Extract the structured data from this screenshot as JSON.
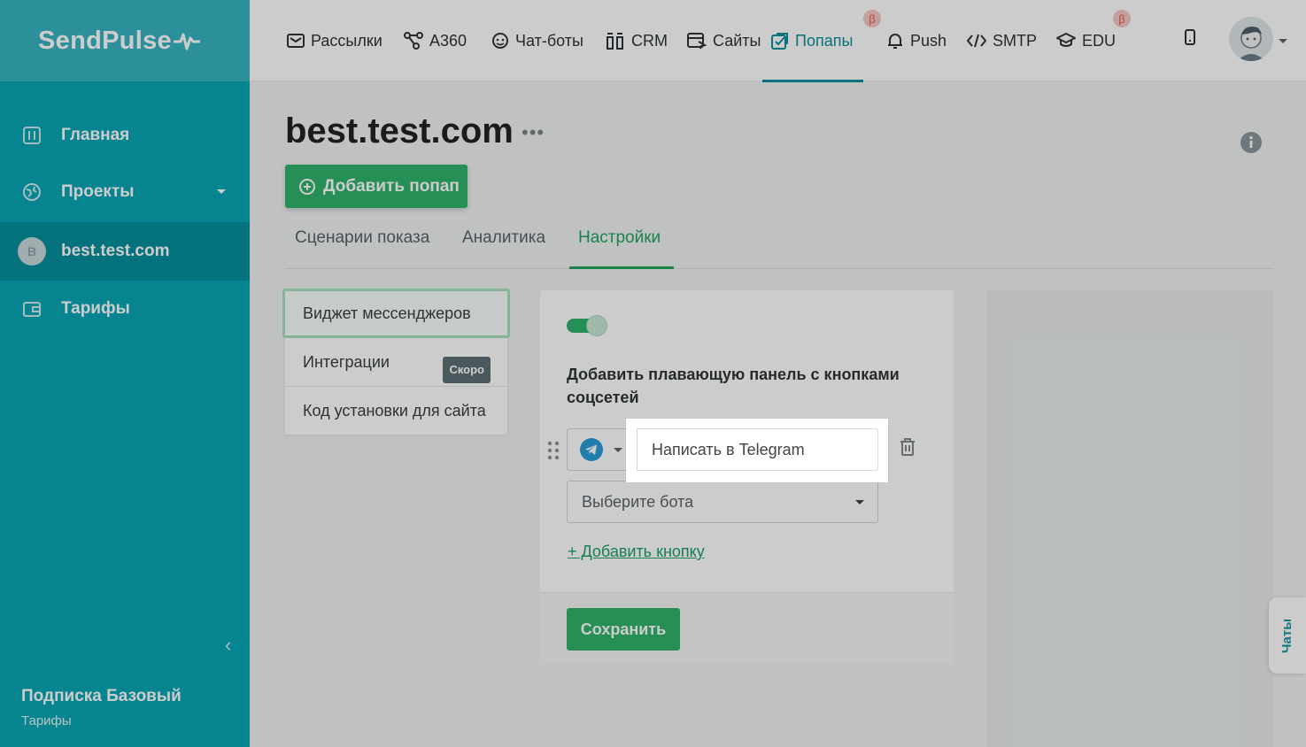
{
  "sidebar": {
    "brand": "SendPulse",
    "items": [
      {
        "label": "Главная",
        "icon": "dashboard-icon"
      },
      {
        "label": "Проекты",
        "icon": "globe-icon"
      },
      {
        "label": "best.test.com",
        "avatar": "B"
      },
      {
        "label": "Тарифы",
        "icon": "wallet-icon"
      }
    ],
    "plan_title": "Подписка Базовый",
    "plan_link": "Тарифы"
  },
  "topnav": [
    {
      "label": "Рассылки",
      "icon": "mail-icon"
    },
    {
      "label": "A360",
      "icon": "automation-icon"
    },
    {
      "label": "Чат-боты",
      "icon": "chatbot-icon"
    },
    {
      "label": "CRM",
      "icon": "crm-icon"
    },
    {
      "label": "Сайты",
      "icon": "site-icon"
    },
    {
      "label": "Попапы",
      "icon": "popup-icon",
      "active": true,
      "beta": "β"
    },
    {
      "label": "Push",
      "icon": "bell-icon"
    },
    {
      "label": "SMTP",
      "icon": "code-icon"
    },
    {
      "label": "EDU",
      "icon": "graduation-cap-icon",
      "beta": "β"
    }
  ],
  "page": {
    "title": "best.test.com",
    "more": "•••",
    "add_popup": "Добавить попап",
    "tabs": [
      "Сценарии показа",
      "Аналитика",
      "Настройки"
    ],
    "active_tab": "Настройки"
  },
  "settings_menu": [
    {
      "label": "Виджет мессенджеров",
      "selected": true
    },
    {
      "label": "Интеграции",
      "badge": "Скоро"
    },
    {
      "label": "Код установки для сайта"
    }
  ],
  "widget": {
    "enabled": true,
    "title": "Добавить плавающую панель с кнопками соцсетей",
    "messenger": "telegram",
    "button_text": "Написать в Telegram",
    "bot_placeholder": "Выберите бота",
    "add_button": "+ Добавить кнопку",
    "save": "Сохранить"
  },
  "chats_tab": "Чаты",
  "colors": {
    "sidebar": "#08a6b4",
    "accent": "#2fb36b",
    "active_nav": "#0b8f9d"
  }
}
